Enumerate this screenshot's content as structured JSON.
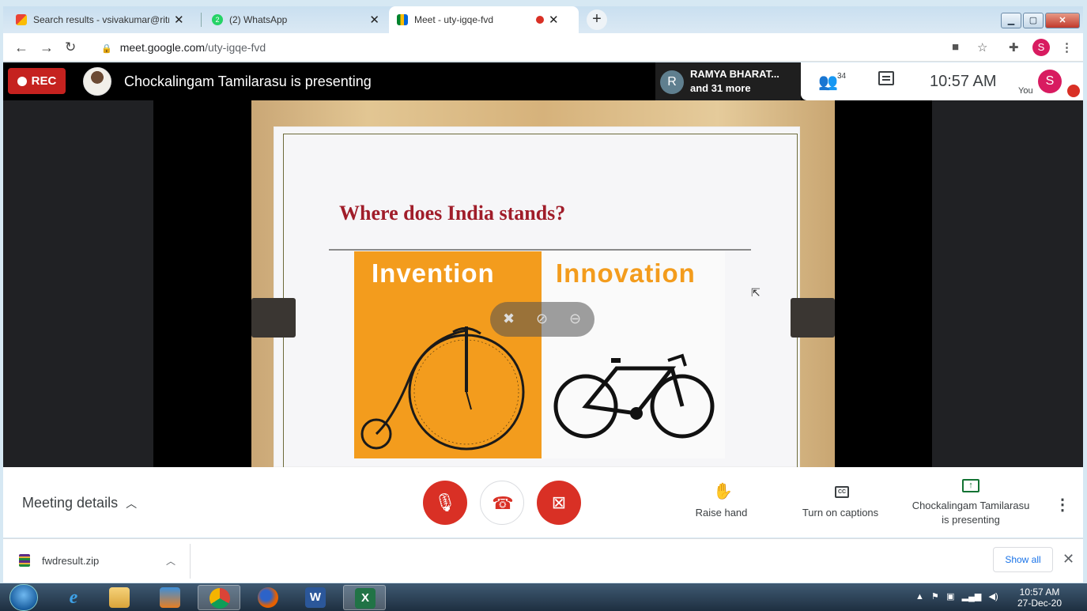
{
  "browser": {
    "tabs": [
      {
        "label": "Search results - vsivakumar@ritrj",
        "icon": "gmail-icon",
        "active": false
      },
      {
        "label": "(2) WhatsApp",
        "icon": "whatsapp-icon",
        "badge": "2",
        "active": false
      },
      {
        "label": "Meet - uty-igqe-fvd",
        "icon": "meet-icon",
        "active": true
      }
    ],
    "url_host": "meet.google.com",
    "url_path": "/uty-igqe-fvd",
    "profile_initial": "S"
  },
  "meet": {
    "rec_label": "REC",
    "presenting_title": "Chockalingam Tamilarasu is presenting",
    "participants_chip": {
      "avatar_initial": "R",
      "name": "RAMYA BHARAT...",
      "more": "and 31 more"
    },
    "participant_count": "34",
    "clock": "10:57  AM",
    "you_label": "You",
    "you_initial": "S"
  },
  "slide": {
    "title": "Where does India stands?",
    "left_word": "Invention",
    "right_word": "Innovation",
    "accent_orange": "#f39c1d",
    "title_red": "#a01d2a"
  },
  "controls": {
    "meeting_details": "Meeting details",
    "raise_hand": "Raise hand",
    "captions": "Turn on captions",
    "presenting_line1": "Chockalingam Tamilarasu",
    "presenting_line2": "is presenting"
  },
  "downloads": {
    "file_name": "fwdresult.zip",
    "show_all": "Show all"
  },
  "taskbar": {
    "time": "10:57 AM",
    "date": "27-Dec-20",
    "apps": [
      "internet-explorer-icon",
      "file-explorer-icon",
      "media-player-icon",
      "chrome-icon",
      "firefox-icon",
      "word-icon",
      "excel-icon"
    ]
  }
}
